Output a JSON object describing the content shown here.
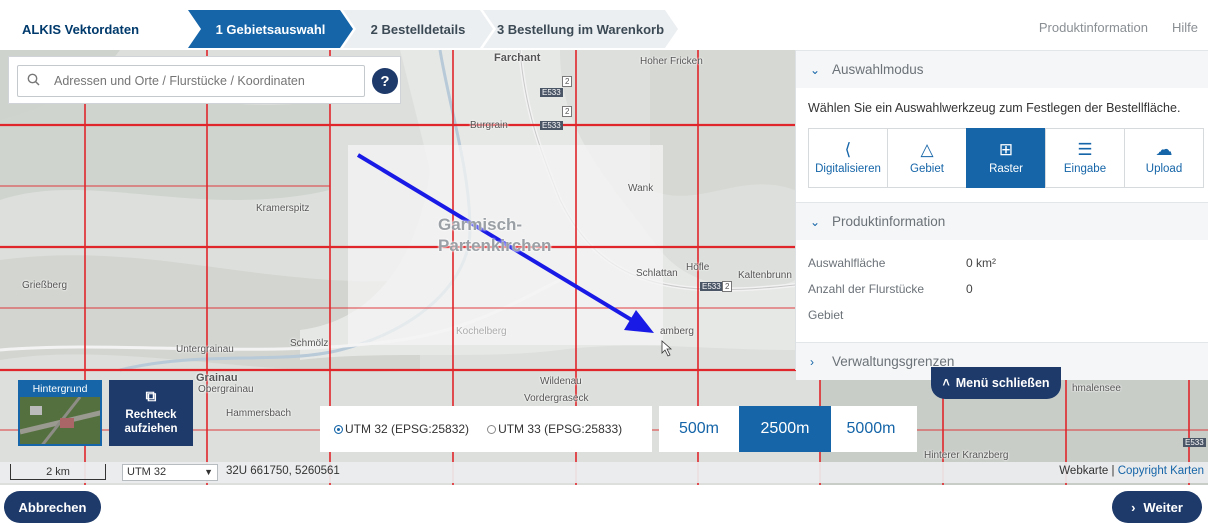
{
  "header": {
    "app_title": "ALKIS Vektordaten",
    "steps": [
      {
        "label": "1 Gebietsauswahl"
      },
      {
        "label": "2 Bestelldetails"
      },
      {
        "label": "3 Bestellung im Warenkorb"
      }
    ],
    "links": {
      "product_info": "Produktinformation",
      "help": "Hilfe"
    }
  },
  "search": {
    "placeholder": "Adressen und Orte / Flurstücke / Koordinaten",
    "help_label": "?"
  },
  "map": {
    "place_labels": [
      "Farchant",
      "Hoher Fricken",
      "Burgrain",
      "Wank",
      "Kramerspitz",
      "Garmisch-",
      "Partenkirchen",
      "Schlattan",
      "Höfle",
      "Kaltenbrunn",
      "Grießberg",
      "Kochelberg",
      "amberg",
      "Untergrainau",
      "Schmölz",
      "Grainau",
      "Obergrainau",
      "Hammersbach",
      "Wildenau",
      "Vordergraseck",
      "Hinterer Kranzberg",
      "hmalensee"
    ],
    "road_labels": [
      "E533",
      "E533",
      "E533",
      "E533",
      "2",
      "2",
      "2"
    ]
  },
  "panel": {
    "section_selection_mode": "Auswahlmodus",
    "selection_desc": "Wählen Sie ein Auswahlwerkzeug zum Festlegen der Bestellfläche.",
    "tools": [
      {
        "label": "Digitalisieren",
        "icon": "share-icon",
        "active": false
      },
      {
        "label": "Gebiet",
        "icon": "triangle-icon",
        "active": false
      },
      {
        "label": "Raster",
        "icon": "grid-icon",
        "active": true
      },
      {
        "label": "Eingabe",
        "icon": "list-icon",
        "active": false
      },
      {
        "label": "Upload",
        "icon": "cloud-upload-icon",
        "active": false
      }
    ],
    "section_product_info": "Produktinformation",
    "info": [
      {
        "key": "Auswahlfläche",
        "value": "0 km²"
      },
      {
        "key": "Anzahl der Flurstücke",
        "value": "0"
      },
      {
        "key": "Gebiet",
        "value": ""
      }
    ],
    "section_admin_bounds": "Verwaltungsgrenzen",
    "menu_close": "Menü schließen"
  },
  "map_tools": {
    "background_label": "Hintergrund",
    "rect_label_1": "Rechteck",
    "rect_label_2": "aufziehen",
    "projections": [
      {
        "label": "UTM 32 (EPSG:25832)",
        "selected": true
      },
      {
        "label": "UTM 33 (EPSG:25833)",
        "selected": false
      }
    ],
    "grid_sizes": [
      {
        "label": "500m",
        "active": false
      },
      {
        "label": "2500m",
        "active": true
      },
      {
        "label": "5000m",
        "active": false
      }
    ]
  },
  "statusbar": {
    "scale": "2 km",
    "crs": "UTM 32",
    "coords": "32U 661750, 5260561",
    "attrib_text": "Webkarte",
    "attrib_sep": "|",
    "attrib_link": "Copyright Karten"
  },
  "footer": {
    "cancel": "Abbrechen",
    "next": "Weiter"
  },
  "colors": {
    "primary": "#1565a8",
    "dark": "#1e3a6a",
    "grid": "#e0262a",
    "arrow": "#1a1ae6"
  }
}
